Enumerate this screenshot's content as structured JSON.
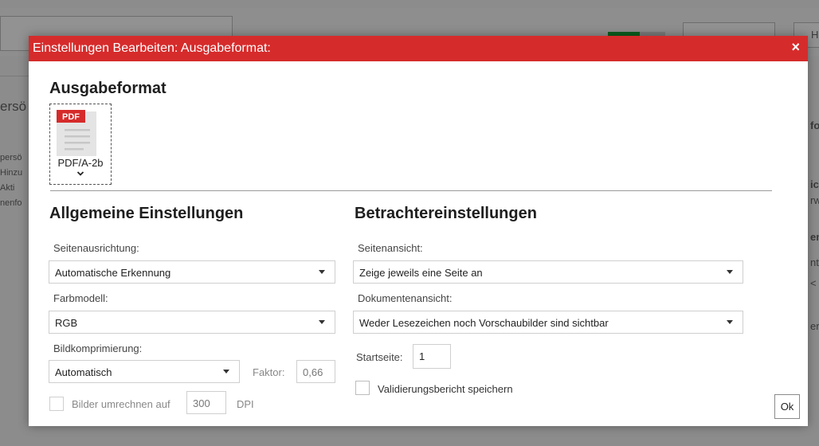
{
  "background": {
    "left_labels": [
      "ersö",
      "persö",
      "Hinzu",
      "Akti",
      "nenfo"
    ],
    "right_labels": [
      "for",
      "ich",
      "rw",
      "en:",
      "nt.",
      "<",
      "er:"
    ],
    "top_right_label": "Hin"
  },
  "dialog": {
    "title": "Einstellungen Bearbeiten: Ausgabeformat:",
    "close_glyph": "×",
    "output_format": {
      "heading": "Ausgabeformat",
      "icon_badge": "PDF",
      "selected": "PDF/A-2b"
    },
    "general": {
      "heading": "Allgemeine Einstellungen",
      "orientation_label": "Seitenausrichtung:",
      "orientation_value": "Automatische Erkennung",
      "color_model_label": "Farbmodell:",
      "color_model_value": "RGB",
      "compression_label": "Bildkomprimierung:",
      "compression_value": "Automatisch",
      "factor_label": "Faktor:",
      "factor_value": "0,66",
      "convert_images_label": "Bilder umrechnen auf",
      "dpi_value": "300",
      "dpi_unit": "DPI"
    },
    "viewer": {
      "heading": "Betrachtereinstellungen",
      "page_view_label": "Seitenansicht:",
      "page_view_value": "Zeige jeweils eine Seite an",
      "document_view_label": "Dokumentenansicht:",
      "document_view_value": "Weder Lesezeichen noch Vorschaubilder sind sichtbar",
      "start_page_label": "Startseite:",
      "start_page_value": "1",
      "save_validation_label": "Validierungsbericht speichern"
    },
    "ok_label": "Ok"
  },
  "colors": {
    "titlebar": "#d62b2b",
    "pdf_badge": "#d62b2b",
    "toggle_on": "#0b5d1e"
  }
}
